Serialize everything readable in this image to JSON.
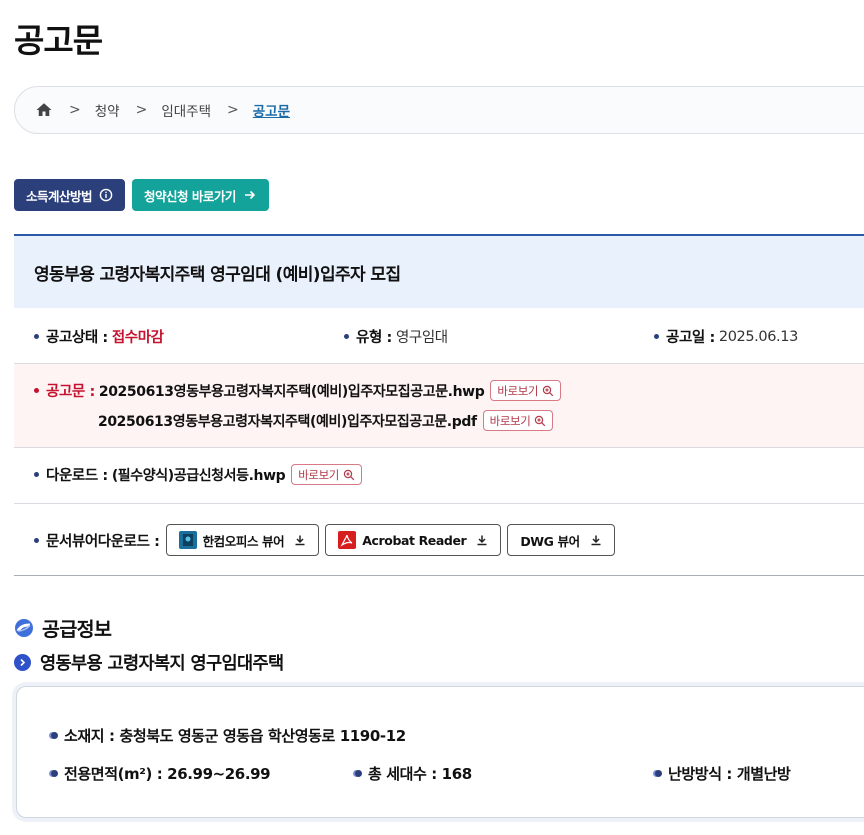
{
  "page": {
    "title": "공고문"
  },
  "breadcrumb": {
    "home_icon": "home-icon",
    "items": [
      "청약",
      "임대주택"
    ],
    "current": "공고문"
  },
  "buttons": {
    "income_calc": "소득계산방법",
    "apply": "청약신청 바로가기",
    "colors": {
      "navy": "#2b3f7a",
      "teal": "#14a39a"
    }
  },
  "notice": {
    "title": "영동부용 고령자복지주택 영구임대 (예비)입주자 모집",
    "status_label": "공고상태 :",
    "status_value": "접수마감",
    "type_label": "유형 :",
    "type_value": "영구임대",
    "date_label": "공고일 :",
    "date_value": "2025.06.13",
    "doc_label": "공고문 :",
    "files": [
      "20250613영동부용고령자복지주택(예비)입주자모집공고문.hwp",
      "20250613영동부용고령자복지주택(예비)입주자모집공고문.pdf"
    ],
    "view_label": "바로보기",
    "download_label": "다운로드 :",
    "download_file": "(필수양식)공급신청서등.hwp",
    "viewer_label": "문서뷰어다운로드 :",
    "viewers": [
      "한컴오피스 뷰어",
      "Acrobat Reader",
      "DWG 뷰어"
    ]
  },
  "supply": {
    "section_title": "공급정보",
    "complex_title": "영동부용 고령자복지 영구임대주택",
    "location": "소재지 : 충청북도 영동군 영동읍 학산영동로 1190-12",
    "area": "전용면적(m²) : 26.99~26.99",
    "households": "총 세대수 : 168",
    "heating": "난방방식 : 개별난방"
  }
}
